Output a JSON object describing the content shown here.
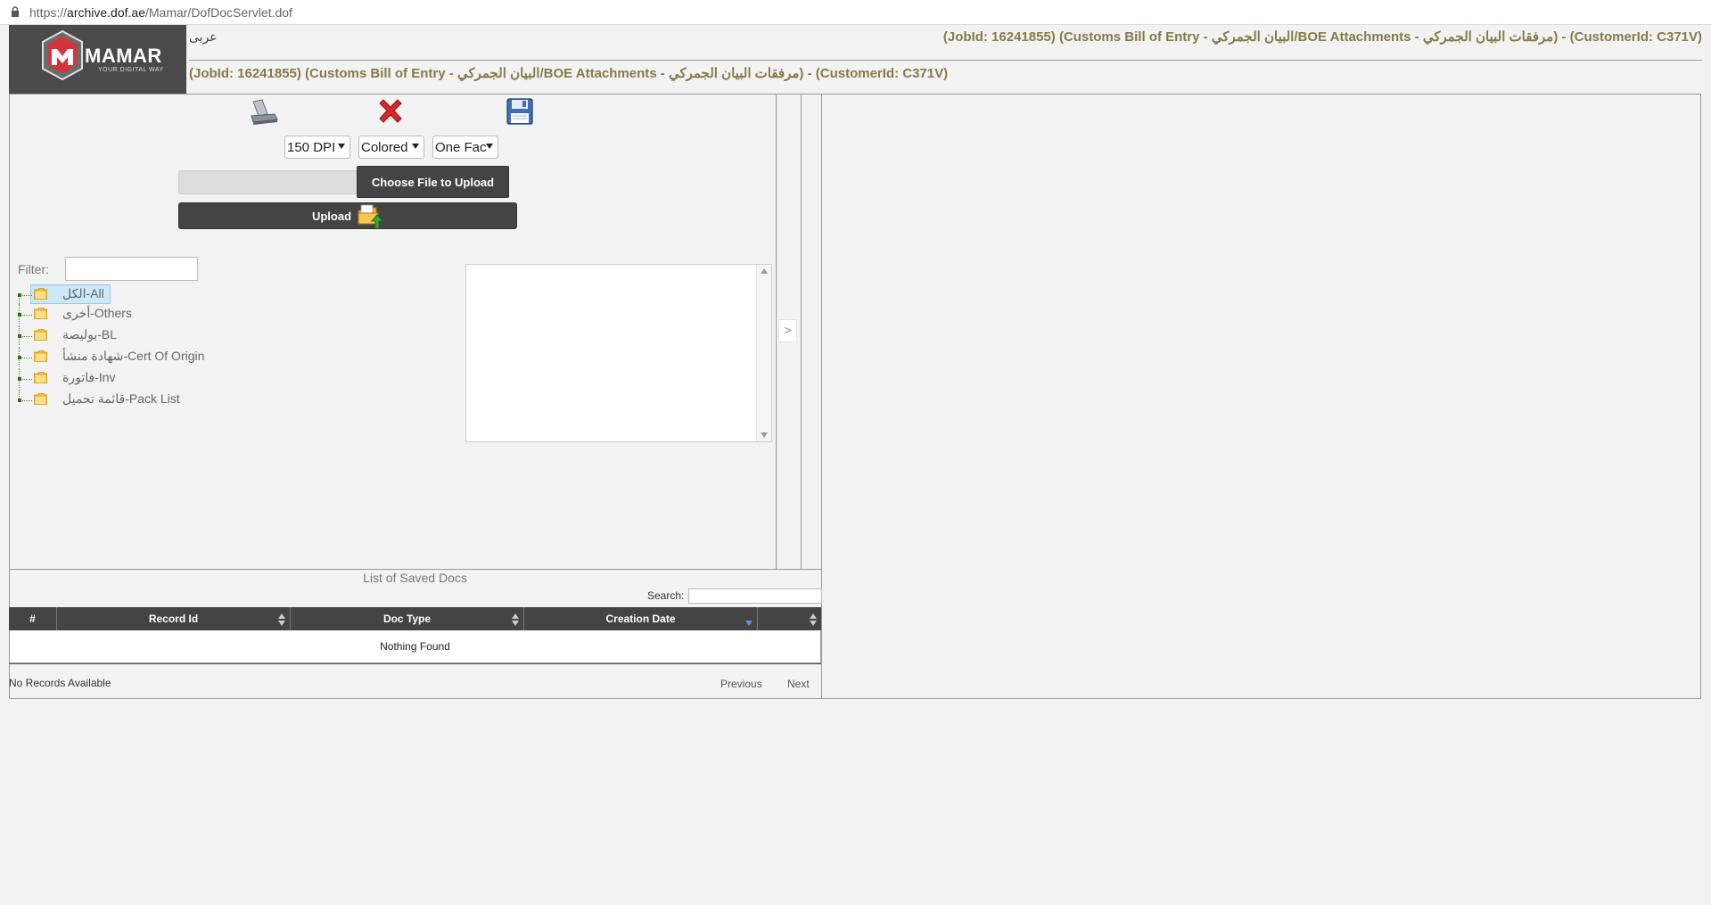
{
  "browser": {
    "url_scheme": "https://",
    "url_host": "archive.dof.ae",
    "url_path": "/Mamar/DofDocServlet.dof"
  },
  "brand": {
    "name": "MAMAR",
    "tagline": "YOUR DIGITAL WAY",
    "logo_color": "#d6333b"
  },
  "header": {
    "language_link": "عربى",
    "title_right": "(JobId: 16241855) (Customs Bill of Entry - البيان الجمركي/BOE Attachments - مرفقات البيان الجمركي) - (CustomerId: C371V)",
    "title_left": "(JobId: 16241855) (Customs Bill of Entry - البيان الجمركي/BOE Attachments - مرفقات البيان الجمركي) - (CustomerId: C371V)",
    "title_color": "#857a48"
  },
  "toolbar": {
    "scan_icon": "scanner-icon",
    "delete_icon": "delete-x-icon",
    "save_icon": "floppy-disk-icon"
  },
  "scan_options": {
    "dpi": {
      "selected": "150 DPI",
      "options": [
        "150 DPI"
      ]
    },
    "color": {
      "selected": "Colored",
      "options": [
        "Colored"
      ]
    },
    "face": {
      "selected": "One Fac",
      "options": [
        "One Fac"
      ]
    }
  },
  "upload": {
    "choose_label": "Choose File to Upload",
    "upload_label": "Upload",
    "upload_icon": "folder-upload-icon"
  },
  "filter": {
    "label": "Filter:",
    "value": ""
  },
  "tree": {
    "items": [
      {
        "label": "الكل-All",
        "selected": true
      },
      {
        "label": "أخرى-Others",
        "selected": false
      },
      {
        "label": "بوليصة-BL",
        "selected": false
      },
      {
        "label": "شهادة منشأ-Cert Of Origin",
        "selected": false
      },
      {
        "label": "فاتورة-Inv",
        "selected": false
      },
      {
        "label": "قائمة تحميل-Pack List",
        "selected": false
      }
    ]
  },
  "expander": {
    "glyph": ">"
  },
  "saved_docs": {
    "title": "List of Saved Docs",
    "search_label": "Search:",
    "search_value": "",
    "columns": [
      "#",
      "Record Id",
      "Doc Type",
      "Creation Date",
      ""
    ],
    "empty_message": "Nothing Found",
    "info": "No Records Available",
    "prev_label": "Previous",
    "next_label": "Next"
  }
}
